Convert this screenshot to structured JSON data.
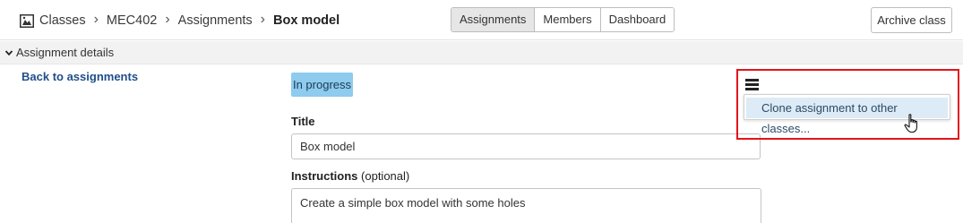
{
  "breadcrumb": {
    "home_icon": "classes-icon",
    "items": [
      "Classes",
      "MEC402",
      "Assignments"
    ],
    "current": "Box model",
    "separator": "chevron-right-icon"
  },
  "tabs": [
    {
      "label": "Assignments",
      "active": true
    },
    {
      "label": "Members",
      "active": false
    },
    {
      "label": "Dashboard",
      "active": false
    }
  ],
  "archive_label": "Archive class",
  "section": {
    "label": "Assignment details",
    "icon": "chevron-down-icon"
  },
  "back_link": "Back to assignments",
  "status": {
    "label": "In progress",
    "color": "#8ecbee"
  },
  "title_field": {
    "label": "Title",
    "value": "Box model"
  },
  "instructions": {
    "label": "Instructions",
    "optional": "(optional)",
    "value": "Create a simple box model with some holes"
  },
  "menu": {
    "icon": "hamburger-menu-icon",
    "items": [
      "Clone assignment to other classes..."
    ]
  },
  "colors": {
    "highlight": "#e3141b",
    "link": "#1f4e8a",
    "menu_hover": "#dcebf6"
  }
}
